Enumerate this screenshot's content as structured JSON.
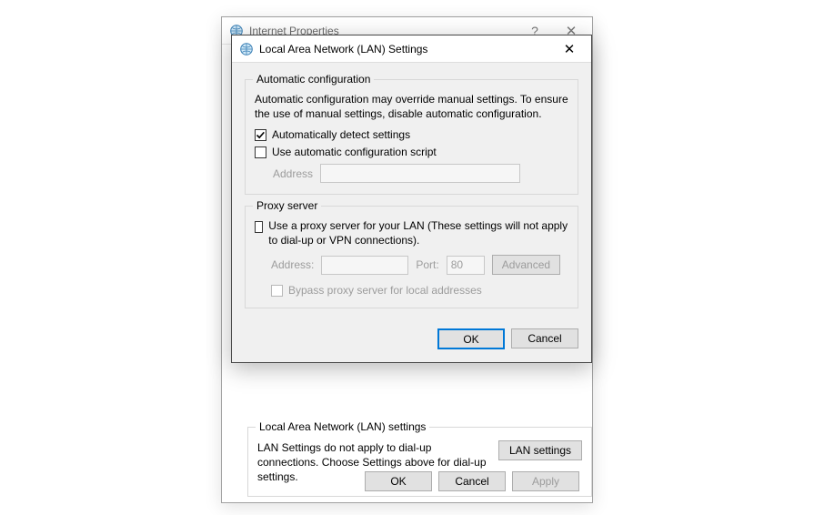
{
  "parent": {
    "title": "Internet Properties",
    "lan_group_title": "Local Area Network (LAN) settings",
    "lan_help_text": "LAN Settings do not apply to dial-up connections. Choose Settings above for dial-up settings.",
    "lan_settings_btn": "LAN settings",
    "ok": "OK",
    "cancel": "Cancel",
    "apply": "Apply"
  },
  "lan": {
    "title": "Local Area Network (LAN) Settings",
    "auto": {
      "group_title": "Automatic configuration",
      "help": "Automatic configuration may override manual settings.  To ensure the use of manual settings, disable automatic configuration.",
      "detect_label": "Automatically detect settings",
      "detect_checked": true,
      "script_label": "Use automatic configuration script",
      "script_checked": false,
      "address_label": "Address",
      "address_value": ""
    },
    "proxy": {
      "group_title": "Proxy server",
      "use_label": "Use a proxy server for your LAN (These settings will not apply to dial-up or VPN connections).",
      "use_checked": false,
      "address_label": "Address:",
      "address_value": "",
      "port_label": "Port:",
      "port_value": "80",
      "advanced_btn": "Advanced",
      "bypass_label": "Bypass proxy server for local addresses",
      "bypass_checked": false
    },
    "ok": "OK",
    "cancel": "Cancel"
  }
}
